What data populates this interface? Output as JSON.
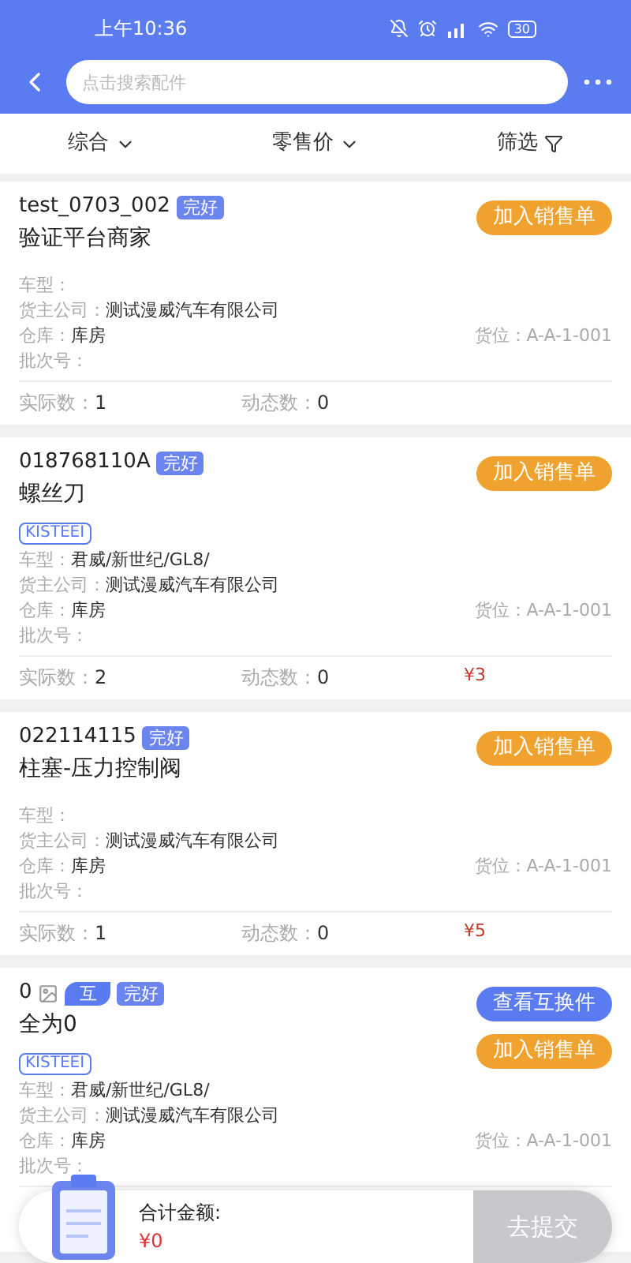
{
  "status_bar": {
    "time": "上午10:36",
    "battery": "30"
  },
  "search": {
    "placeholder": "点击搜索配件"
  },
  "sort_bar": [
    {
      "label": "综合",
      "kind": "dropdown"
    },
    {
      "label": "零售价",
      "kind": "dropdown"
    },
    {
      "label": "筛选",
      "kind": "filter"
    }
  ],
  "parts": [
    {
      "code": "test_0703_002",
      "image": false,
      "badges": [
        {
          "text": "完好",
          "kind": "condition"
        }
      ],
      "name": "验证平台商家",
      "fields": [
        {
          "label": "车型："
        },
        {
          "label": "货主公司：",
          "value": "测试漫威汽车有限公司"
        },
        {
          "label": "仓库：",
          "value": "库房",
          "extra_label": "货位：",
          "extra_value": "A-A-1-001"
        },
        {
          "label": "批次号："
        }
      ],
      "stats": [
        {
          "label": "实际数：",
          "value": "1"
        },
        {
          "label": "动态数：",
          "value": "0"
        }
      ],
      "buttons": [
        {
          "text": "加入销售单",
          "kind": "add"
        }
      ]
    },
    {
      "code": "018768110A",
      "image": false,
      "badges": [
        {
          "text": "完好",
          "kind": "condition"
        }
      ],
      "name": "螺丝刀",
      "brand": "KISTEEI",
      "fields": [
        {
          "label": "车型：",
          "value": "君威/新世纪/GL8/"
        },
        {
          "label": "货主公司：",
          "value": "测试漫威汽车有限公司"
        },
        {
          "label": "仓库：",
          "value": "库房",
          "extra_label": "货位：",
          "extra_value": "A-A-1-001"
        },
        {
          "label": "批次号："
        }
      ],
      "stats": [
        {
          "label": "实际数：",
          "value": "2"
        },
        {
          "label": "动态数：",
          "value": "0"
        }
      ],
      "price": "¥3",
      "buttons": [
        {
          "text": "加入销售单",
          "kind": "add"
        }
      ]
    },
    {
      "code": "022114115",
      "image": false,
      "badges": [
        {
          "text": "完好",
          "kind": "condition"
        }
      ],
      "name": "柱塞-压力控制阀",
      "fields": [
        {
          "label": "车型："
        },
        {
          "label": "货主公司：",
          "value": "测试漫威汽车有限公司"
        },
        {
          "label": "仓库：",
          "value": "库房",
          "extra_label": "货位：",
          "extra_value": "A-A-1-001"
        },
        {
          "label": "批次号："
        }
      ],
      "stats": [
        {
          "label": "实际数：",
          "value": "1"
        },
        {
          "label": "动态数：",
          "value": "0"
        }
      ],
      "price": "¥5",
      "buttons": [
        {
          "text": "加入销售单",
          "kind": "add"
        }
      ]
    },
    {
      "code": "0",
      "image": true,
      "badges": [
        {
          "text": "互",
          "kind": "interchange"
        },
        {
          "text": "完好",
          "kind": "condition"
        }
      ],
      "name": "全为0",
      "brand": "KISTEEI",
      "fields": [
        {
          "label": "车型：",
          "value": "君威/新世纪/GL8/"
        },
        {
          "label": "货主公司：",
          "value": "测试漫威汽车有限公司"
        },
        {
          "label": "仓库：",
          "value": "库房",
          "extra_label": "货位：",
          "extra_value": "A-A-1-001"
        },
        {
          "label": "批次号："
        }
      ],
      "buttons": [
        {
          "text": "查看互换件",
          "kind": "interchange"
        },
        {
          "text": "加入销售单",
          "kind": "add"
        }
      ]
    }
  ],
  "cart": {
    "total_label": "合计金额:",
    "total": "¥0",
    "submit": "去提交",
    "submit_disabled": true
  }
}
